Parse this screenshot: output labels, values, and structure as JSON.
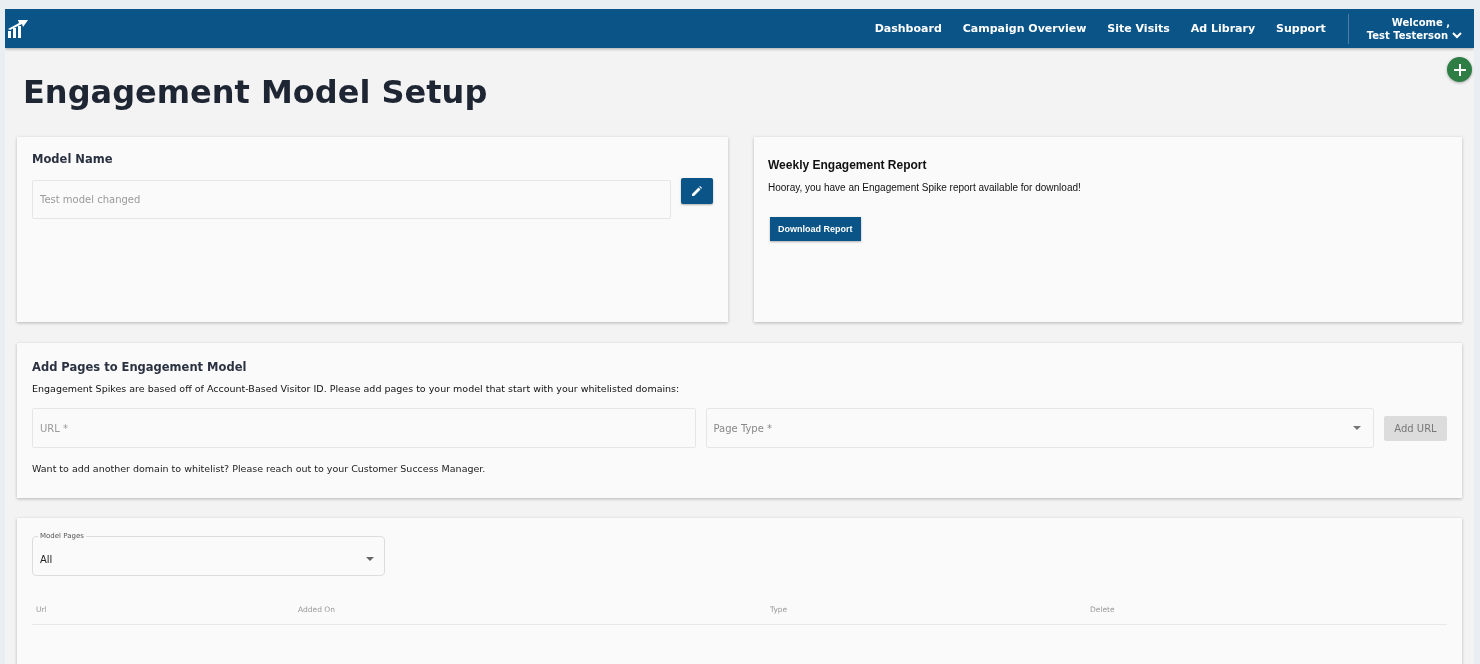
{
  "nav": {
    "links": [
      {
        "label": "Dashboard"
      },
      {
        "label": "Campaign Overview"
      },
      {
        "label": "Site Visits"
      },
      {
        "label": "Ad Library"
      },
      {
        "label": "Support"
      }
    ],
    "welcome": "Welcome ,",
    "user": "Test Testerson"
  },
  "title": "Engagement Model Setup",
  "model_name": {
    "heading": "Model Name",
    "placeholder": "Test model changed"
  },
  "report": {
    "heading": "Weekly Engagement Report",
    "message": "Hooray, you have an Engagement Spike report available for download!",
    "button": "Download Report"
  },
  "add_pages": {
    "heading": "Add Pages to Engagement Model",
    "description": "Engagement Spikes are based off of Account-Based Visitor ID. Please add pages to your model that start with your whitelisted domains:",
    "url_placeholder": "URL *",
    "page_type_placeholder": "Page Type *",
    "add_button": {
      "label": "Add URL",
      "disabled": true
    },
    "note": "Want to add another domain to whitelist? Please reach out to your Customer Success Manager."
  },
  "model_pages": {
    "filter": {
      "label": "Model Pages",
      "value": "All"
    },
    "table": {
      "columns": [
        "Url",
        "Added On",
        "Type",
        "Delete"
      ]
    }
  }
}
